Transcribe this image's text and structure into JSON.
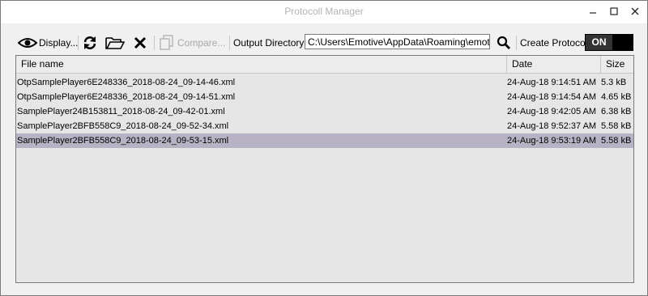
{
  "window": {
    "title": "Protocoll Manager",
    "minimize_icon": "minimize-icon",
    "maximize_icon": "maximize-icon",
    "close_icon": "close-icon"
  },
  "toolbar": {
    "display_label": "Display...",
    "compare_label": "Compare...",
    "output_directory_label": "Output Directory",
    "output_directory_value": "C:\\Users\\Emotive\\AppData\\Roaming\\emotive",
    "create_protocol_label": "Create Protocol",
    "toggle_label": "ON"
  },
  "table": {
    "headers": {
      "name": "File name",
      "date": "Date",
      "size": "Size"
    },
    "rows": [
      {
        "name": "OtpSamplePlayer6E248336_2018-08-24_09-14-46.xml",
        "date": "24-Aug-18 9:14:51 AM",
        "size": "5.3 kB"
      },
      {
        "name": "OtpSamplePlayer6E248336_2018-08-24_09-14-51.xml",
        "date": "24-Aug-18 9:14:54 AM",
        "size": "4.65 kB"
      },
      {
        "name": "SamplePlayer24B153811_2018-08-24_09-42-01.xml",
        "date": "24-Aug-18 9:42:05 AM",
        "size": "6.38 kB"
      },
      {
        "name": "SamplePlayer2BFB558C9_2018-08-24_09-52-34.xml",
        "date": "24-Aug-18 9:52:37 AM",
        "size": "5.58 kB"
      },
      {
        "name": "SamplePlayer2BFB558C9_2018-08-24_09-53-15.xml",
        "date": "24-Aug-18 9:53:19 AM",
        "size": "5.58 kB",
        "selected": true
      }
    ]
  },
  "colors": {
    "selected_row": "#b7b3c4",
    "toggle_bg": "#000000"
  }
}
